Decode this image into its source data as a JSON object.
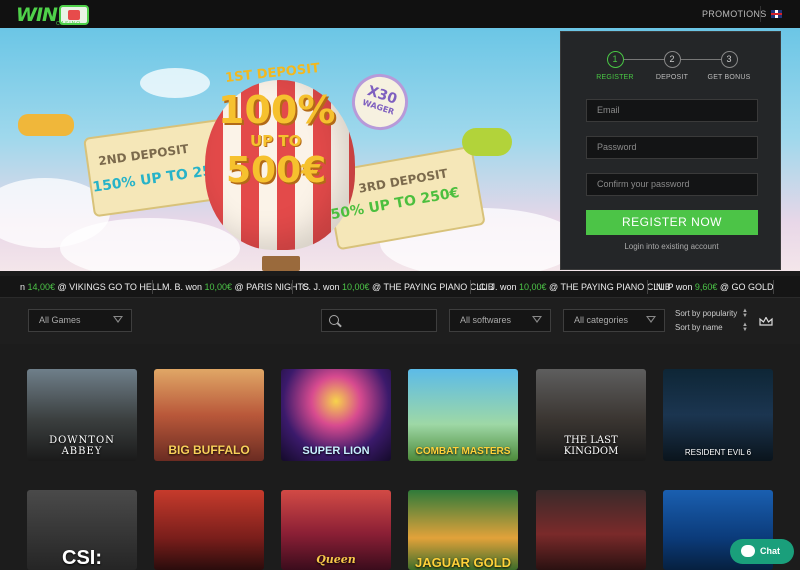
{
  "header": {
    "logo_text": "WIN",
    "logo_sub": "CASINO",
    "promotions": "PROMOTIONS",
    "language_icon": "uk-flag-icon"
  },
  "hero": {
    "deposit1_label": "1ST DEPOSIT",
    "deposit1_main": "100%",
    "deposit1_upto": "UP TO",
    "deposit1_amount": "500€",
    "wager_times": "X30",
    "wager_label": "WAGER",
    "deposit2_label": "2ND DEPOSIT",
    "deposit2_bonus": "150% UP TO 250€",
    "deposit3_label": "3RD DEPOSIT",
    "deposit3_bonus": "50% UP TO 250€"
  },
  "register": {
    "steps": [
      {
        "num": "1",
        "label": "REGISTER"
      },
      {
        "num": "2",
        "label": "DEPOSIT"
      },
      {
        "num": "3",
        "label": "GET BONUS"
      }
    ],
    "email_placeholder": "Email",
    "password_placeholder": "Password",
    "confirm_placeholder": "Confirm your password",
    "button": "REGISTER NOW",
    "login_link": "Login into existing account"
  },
  "ticker": [
    {
      "prefix": "n ",
      "amount": "14,00€",
      "rest": " @ VIKINGS GO TO HELL"
    },
    {
      "prefix": "M. B. won ",
      "amount": "10,00€",
      "rest": " @ PARIS NIGHTS"
    },
    {
      "prefix": "C. J. won ",
      "amount": "10,00€",
      "rest": " @ THE PAYING PIANO CLUB"
    },
    {
      "prefix": "C. J. won ",
      "amount": "10,00€",
      "rest": " @ THE PAYING PIANO CLUB"
    },
    {
      "prefix": "N. P won ",
      "amount": "9,60€",
      "rest": " @ GO GOLD"
    }
  ],
  "filters": {
    "games": "All Games",
    "softwares": "All softwares",
    "categories": "All categories",
    "sort_popularity": "Sort by popularity",
    "sort_name": "Sort by name"
  },
  "games_row1": [
    {
      "title": "DOWNTON ABBEY"
    },
    {
      "title": "BIG BUFFALO"
    },
    {
      "title": "SUPER LION"
    },
    {
      "title": "COMBAT MASTERS"
    },
    {
      "title": "THE LAST KINGDOM"
    },
    {
      "title": "RESIDENT EVIL 6"
    }
  ],
  "games_row2": [
    {
      "title": "CSI:"
    },
    {
      "title": ""
    },
    {
      "title": "Queen"
    },
    {
      "title": "JAGUAR GOLD"
    },
    {
      "title": ""
    },
    {
      "title": ""
    }
  ],
  "chat": {
    "label": "Chat"
  },
  "colors": {
    "accent": "#4cc447",
    "background": "#1c1c1c",
    "panel": "#242628"
  }
}
